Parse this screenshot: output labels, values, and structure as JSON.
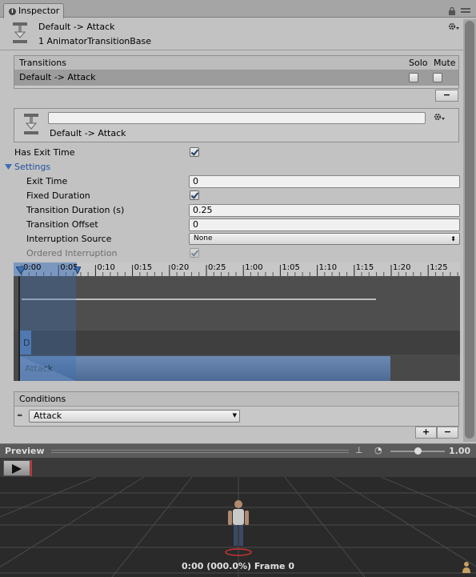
{
  "window": {
    "tab_label": "Inspector",
    "tab_icon": "info-icon"
  },
  "header": {
    "title": "Default -> Attack",
    "subtitle": "1 AnimatorTransitionBase"
  },
  "transitions": {
    "header": "Transitions",
    "solo_label": "Solo",
    "mute_label": "Mute",
    "rows": [
      {
        "name": "Default -> Attack",
        "solo": false,
        "mute": false
      }
    ],
    "remove_button": "−"
  },
  "transition": {
    "name_value": "",
    "label": "Default -> Attack"
  },
  "properties": {
    "has_exit_time": {
      "label": "Has Exit Time",
      "checked": true
    },
    "settings_label": "Settings"
  },
  "settings": {
    "exit_time": {
      "label": "Exit Time",
      "value": "0"
    },
    "fixed_duration": {
      "label": "Fixed Duration",
      "checked": true
    },
    "transition_duration": {
      "label": "Transition Duration (s)",
      "value": "0.25"
    },
    "transition_offset": {
      "label": "Transition Offset",
      "value": "0"
    },
    "interruption_source": {
      "label": "Interruption Source",
      "value": "None"
    },
    "ordered_interruption": {
      "label": "Ordered Interruption",
      "checked": true
    }
  },
  "timeline": {
    "ticks": [
      "0:00",
      "0:05",
      "0:10",
      "0:15",
      "0:20",
      "0:25",
      "1:00",
      "1:05",
      "1:10",
      "1:15",
      "1:20",
      "1:25"
    ],
    "source_state": "D",
    "dest_state": "Attack"
  },
  "conditions": {
    "header": "Conditions",
    "items": [
      {
        "parameter": "Attack"
      }
    ],
    "add_button": "+",
    "remove_button": "−"
  },
  "preview": {
    "label": "Preview",
    "speed": "1.00",
    "status": "0:00 (000.0%) Frame 0",
    "speed_level": 0.5
  },
  "colors": {
    "accent": "#3d6fb5",
    "selected_row": "#9c9c9c",
    "timeline_bg": "#494949"
  }
}
